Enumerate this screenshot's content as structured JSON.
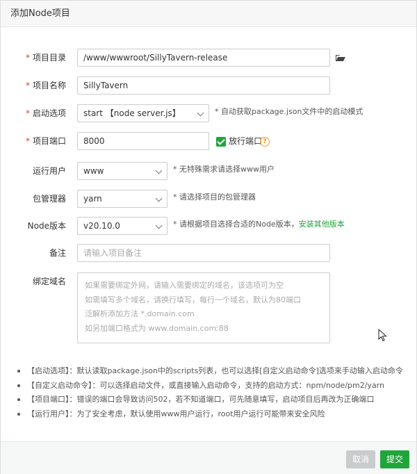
{
  "dialog": {
    "title": "添加Node项目"
  },
  "form": {
    "project_dir": {
      "label": "项目目录",
      "value": "/www/wwwroot/SillyTavern-release"
    },
    "project_name": {
      "label": "项目名称",
      "value": "SillyTavern"
    },
    "start_option": {
      "label": "启动选项",
      "value": "start 【node server.js】",
      "hint": "* 自动获取package.json文件中的启动模式"
    },
    "project_port": {
      "label": "项目端口",
      "value": "8000",
      "open_port_label": "放行端口",
      "open_port_checked": true
    },
    "run_user": {
      "label": "运行用户",
      "value": "www",
      "hint": "* 无特殊需求请选择www用户"
    },
    "package_manager": {
      "label": "包管理器",
      "value": "yarn",
      "hint": "* 请选择项目的包管理器"
    },
    "node_version": {
      "label": "Node版本",
      "value": "v20.10.0",
      "hint": "* 请根据项目选择合适的Node版本，",
      "link": "安装其他版本"
    },
    "remark": {
      "label": "备注",
      "placeholder": "请输入项目备注"
    },
    "domain": {
      "label": "绑定域名",
      "placeholder_lines": [
        "如果需要绑定外网，请输入需要绑定的域名，该选项可为空",
        "如需填写多个域名，请换行填写，每行一个域名，默认为80端口",
        "泛解析添加方法 *.domain.com",
        "如另加端口格式为 www.domain.com:88"
      ]
    }
  },
  "notes": [
    "【启动选项】：默认读取package.json中的scripts列表，也可以选择[自定义启动命令]选项来手动输入启动命令",
    "【自定义启动命令】：可以选择启动文件，或直接输入启动命令，支持的启动方式：npm/node/pm2/yarn",
    "【项目端口】：错误的端口会导致访问502，若不知道端口，可先随意填写，启动项目后再改为正确端口",
    "【运行用户】：为了安全考虑，默认使用www用户运行，root用户运行可能带来安全风险"
  ],
  "footer": {
    "cancel_label": "取消",
    "submit_label": "提交"
  },
  "colors": {
    "accent": "#20a53a",
    "required": "#e53935",
    "help": "#f0a020",
    "cancel_bg": "#c9cccd"
  }
}
